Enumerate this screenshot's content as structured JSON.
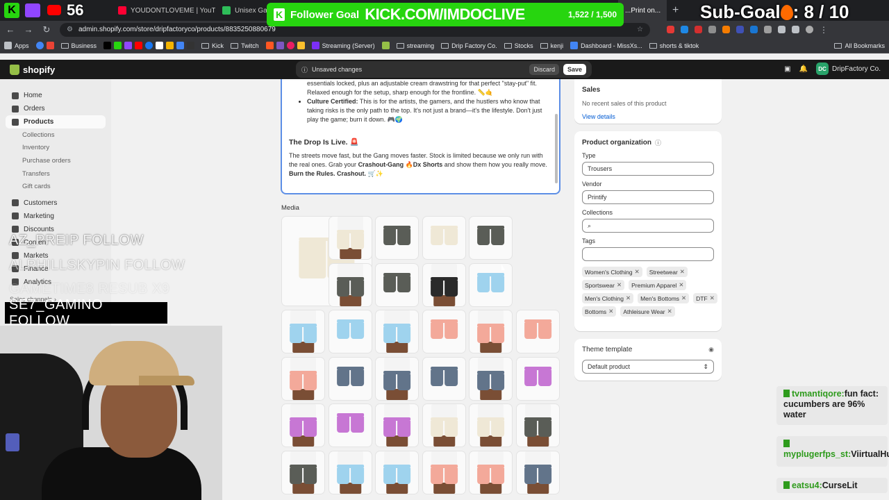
{
  "browser": {
    "tabs": [
      {
        "label": "",
        "color": "#ff4500"
      },
      {
        "label": "YOUDONTLOVEME | YouTube",
        "color": "#ff0033"
      },
      {
        "label": "Unisex Ga...",
        "color": "#2ebd59"
      },
      {
        "label": "...Print on...",
        "color": "#2ebd59"
      }
    ],
    "url": "admin.shopify.com/store/dripfactoryco/products/8835250880679",
    "bookmarks": [
      "Apps",
      "Business",
      "Kick",
      "Twitch",
      "Streaming (Server)",
      "streaming",
      "Drip Factory Co.",
      "Stocks",
      "kenji",
      "Dashboard - MissXs...",
      "shorts & tiktok"
    ],
    "all_bookmarks": "All Bookmarks"
  },
  "shopify": {
    "logo": "shopify",
    "unsaved": "Unsaved changes",
    "discard": "Discard",
    "save": "Save",
    "store_initials": "DC",
    "store_name": "DripFactory Co."
  },
  "sidebar": {
    "home": "Home",
    "orders": "Orders",
    "products": "Products",
    "collections": "Collections",
    "inventory": "Inventory",
    "purchase_orders": "Purchase orders",
    "transfers": "Transfers",
    "gift_cards": "Gift cards",
    "customers": "Customers",
    "marketing": "Marketing",
    "discounts": "Discounts",
    "content": "Content",
    "markets": "Markets",
    "finance": "Finance",
    "analytics": "Analytics",
    "sales_channels": "Sales channels"
  },
  "description": {
    "line1": "essentials locked, plus an adjustable cream drawstring for that perfect \"stay-put\" fit. Relaxed enough for the setup, sharp enough for the frontline. 📏🤙",
    "culture_title": "Culture Certified:",
    "culture_text": " This is for the artists, the gamers, and the hustlers who know that taking risks is the only path to the top. It's not just a brand—it's the lifestyle. Don't just play the game; burn it down. 🎮🌍",
    "drop_title": "The Drop Is Live. 🚨",
    "drop_text_1": "The streets move fast, but the Gang moves faster. Stock is limited because we only run with the real ones. Grab your ",
    "drop_bold_1": "Crashout-Gang 🔥Dx Shorts",
    "drop_text_2": " and show them how you really move. ",
    "drop_bold_2": "Burn the Rules. Crashout. 🛒✨"
  },
  "media": {
    "label": "Media"
  },
  "sales": {
    "title": "Sales",
    "none": "No recent sales of this product",
    "view_details": "View details"
  },
  "organization": {
    "title": "Product organization",
    "type_label": "Type",
    "type_value": "Trousers",
    "vendor_label": "Vendor",
    "vendor_value": "Printify",
    "collections_label": "Collections",
    "tags_label": "Tags",
    "tags": [
      "Women's Clothing",
      "Streetwear",
      "Sportswear",
      "Premium Apparel",
      "Men's Clothing",
      "Men's Bottoms",
      "DTF",
      "Bottoms",
      "Athleisure Wear"
    ]
  },
  "theme": {
    "title": "Theme template",
    "value": "Default product"
  },
  "overlay": {
    "viewers": "56",
    "goal_label": "Follower Goal",
    "goal_url": "KICK.COM/IMDOCLIVE",
    "goal_count": "1,522 / 1,500",
    "subgoal": "Sub-Goal",
    "subgoal_count": ": 8 / 10",
    "follow1": "AZ_PREIP  FOLLOW",
    "follow2": "ALPHILLSKYPIN  FOLLOW",
    "follow3": "GAMETIME8  RESUB X9",
    "follow_box": "SE7_GAMINO  FOLLOW",
    "chat": [
      {
        "user": "tvmantiqore:",
        "text": "fun fact: cucumbers are 96% water"
      },
      {
        "user": "myplugerfps_st:",
        "text": "ViirtualHug"
      },
      {
        "user": "eatsu4:",
        "text": "CurseLit"
      }
    ]
  }
}
